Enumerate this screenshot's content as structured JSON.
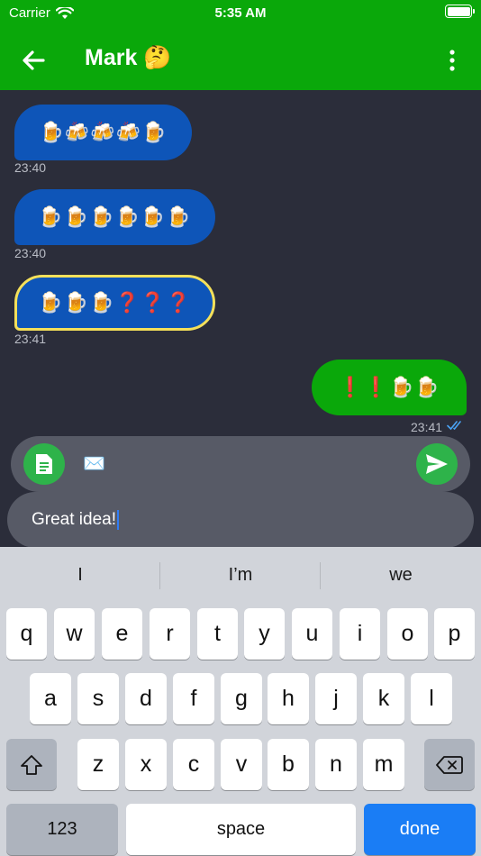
{
  "status": {
    "carrier": "Carrier",
    "time": "5:35 AM"
  },
  "header": {
    "title": "Mark 🤔"
  },
  "messages": [
    {
      "text": "🍺🍻🍻🍻🍺",
      "time": "23:40",
      "direction": "incoming"
    },
    {
      "text": "🍺🍺🍺🍺🍺🍺",
      "time": "23:40",
      "direction": "incoming"
    },
    {
      "text": "🍺🍺🍺❓❓❓",
      "time": "23:41",
      "direction": "incoming"
    },
    {
      "text": "❗❗🍺🍺",
      "time": "23:41",
      "direction": "outgoing"
    }
  ],
  "composer": {
    "attachment_emoji": "✉️",
    "input_value": "Great idea!"
  },
  "keyboard": {
    "suggestions": [
      "I",
      "I’m",
      "we"
    ],
    "row1": [
      "q",
      "w",
      "e",
      "r",
      "t",
      "y",
      "u",
      "i",
      "o",
      "p"
    ],
    "row2": [
      "a",
      "s",
      "d",
      "f",
      "g",
      "h",
      "j",
      "k",
      "l"
    ],
    "row3": [
      "z",
      "x",
      "c",
      "v",
      "b",
      "n",
      "m"
    ],
    "numbers_label": "123",
    "space_label": "space",
    "done_label": "done"
  },
  "colors": {
    "header_green": "#0aa80a",
    "chat_background": "#2b2d3a",
    "incoming_bubble": "#0e55b8",
    "outgoing_bubble": "#0aa80a",
    "highlight_border": "#f4e05a",
    "action_button": "#2eb34a",
    "done_key": "#1a7df5"
  }
}
